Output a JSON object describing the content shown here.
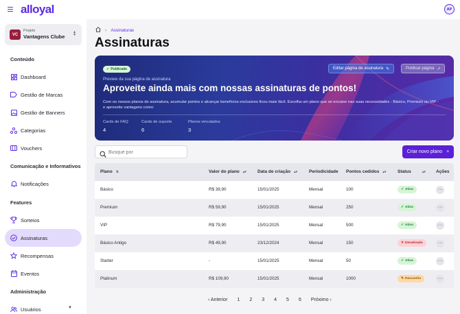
{
  "header": {
    "logo": "alloyal",
    "avatar_initials": "AP"
  },
  "sidebar": {
    "project_label": "Projeto",
    "project_name": "Vantagens Clube",
    "project_logo_text": "VC",
    "sections": {
      "content": "Conteúdo",
      "comms": "Comunicação e Informativos",
      "features": "Features",
      "admin": "Administração"
    },
    "items": [
      {
        "label": "Dashboard",
        "icon": "dashboard-icon"
      },
      {
        "label": "Gestão de Marcas",
        "icon": "tag-icon"
      },
      {
        "label": "Gestão de Banners",
        "icon": "image-icon"
      },
      {
        "label": "Categorias",
        "icon": "categories-icon"
      },
      {
        "label": "Vouchers",
        "icon": "ticket-icon"
      },
      {
        "label": "Notificações",
        "icon": "bell-icon"
      },
      {
        "label": "Sorteios",
        "icon": "trophy-icon"
      },
      {
        "label": "Assinaturas",
        "icon": "check-circle-icon",
        "active": true
      },
      {
        "label": "Recompensas",
        "icon": "star-icon"
      },
      {
        "label": "Eventos",
        "icon": "calendar-icon"
      },
      {
        "label": "Usuários",
        "icon": "users-icon"
      }
    ]
  },
  "breadcrumb": {
    "current": "Assinaturas"
  },
  "page_title": "Assinaturas",
  "hero": {
    "badge": "Publicado",
    "edit_button": "Editar página de assinatura",
    "publish_button": "Publicar página",
    "preview_label": "Preview da sua página de assinatura",
    "title": "Aproveite ainda mais com nossas assinaturas de pontos!",
    "description": "Com os nossos planos de assinatura, acumular pontos e alcançar benefícios exclusivos ficou mais fácil. Escolha um plano que se encaixe nas suas necessidades - Básico, Premium ou VIP - e aproveite vantagens como:",
    "stats": [
      {
        "label": "Cards de FAQ",
        "value": "4"
      },
      {
        "label": "Cards de suporte",
        "value": "6"
      },
      {
        "label": "Planos vinculados",
        "value": "3"
      }
    ]
  },
  "search": {
    "placeholder": "Busque por",
    "value": ""
  },
  "new_plan_button": "Criar novo plano",
  "table": {
    "columns": {
      "plan": "Plano",
      "value": "Valor do plano",
      "created": "Data de criação",
      "period": "Periodicidade",
      "points": "Pontos cedidos",
      "status": "Status",
      "actions": "Ações"
    },
    "rows": [
      {
        "plan": "Básico",
        "value": "R$ 39,90",
        "created": "15/01/2025",
        "period": "Mensal",
        "points": "100",
        "status": "Ativo",
        "status_type": "active"
      },
      {
        "plan": "Premium",
        "value": "R$ 59,90",
        "created": "15/01/2025",
        "period": "Mensal",
        "points": "250",
        "status": "Ativo",
        "status_type": "active"
      },
      {
        "plan": "VIP",
        "value": "R$ 79,90",
        "created": "15/01/2025",
        "period": "Mensal",
        "points": "500",
        "status": "Ativo",
        "status_type": "active"
      },
      {
        "plan": "Básico Antigo",
        "value": "R$ 49,90",
        "created": "23/12/2024",
        "period": "Mensal",
        "points": "150",
        "status": "Desativado",
        "status_type": "disabled"
      },
      {
        "plan": "Starter",
        "value": "-",
        "created": "15/01/2025",
        "period": "Mensal",
        "points": "50",
        "status": "Ativo",
        "status_type": "active"
      },
      {
        "plan": "Platinum",
        "value": "R$ 109,90",
        "created": "15/01/2025",
        "period": "Mensal",
        "points": "1000",
        "status": "Rascunho",
        "status_type": "draft"
      }
    ],
    "action_symbol": "···"
  },
  "pagination": {
    "prev": "Anterior",
    "next": "Próximo",
    "pages": [
      "1",
      "2",
      "3",
      "4",
      "5",
      "6"
    ]
  },
  "colors": {
    "accent": "#5b21d6",
    "active_bg": "#d6f4d6",
    "active_fg": "#1d7a32",
    "disabled_bg": "#fbd2d6",
    "disabled_fg": "#c0212f",
    "draft_bg": "#fbd9a8",
    "draft_fg": "#9a5a00"
  }
}
